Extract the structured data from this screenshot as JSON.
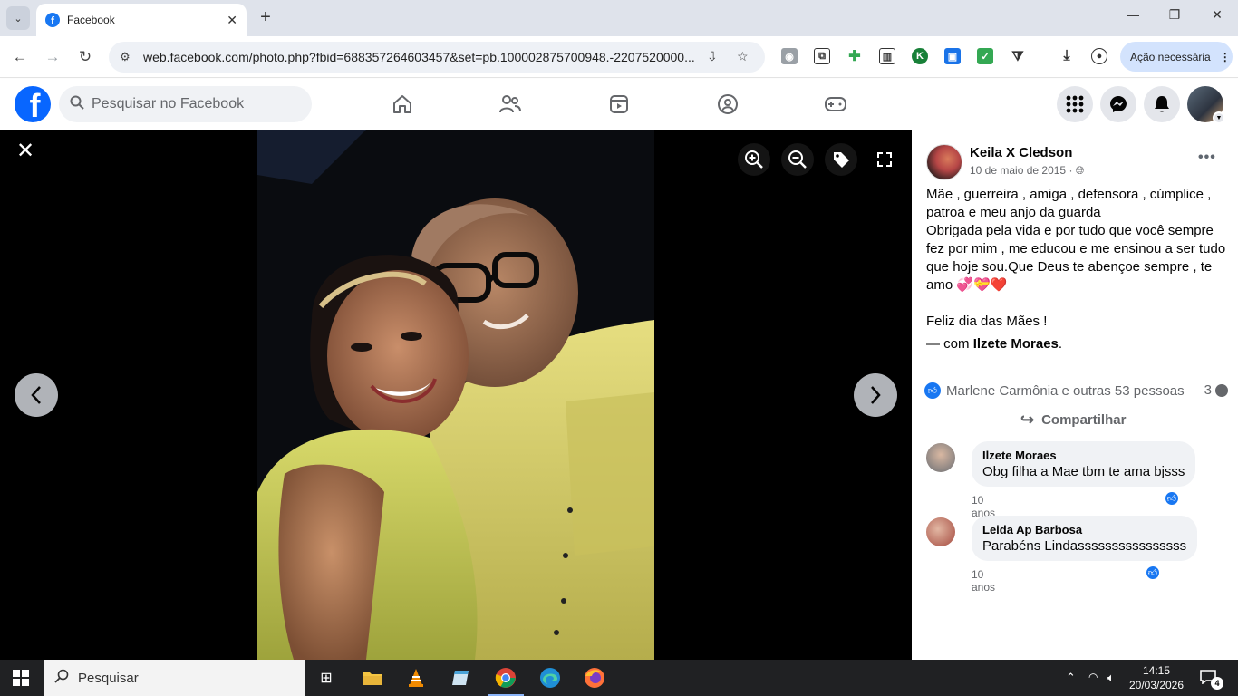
{
  "browser": {
    "tab_title": "Facebook",
    "url": "web.facebook.com/photo.php?fbid=688357264603457&set=pb.100002875700948.-2207520000...",
    "action_button": "Ação necessária"
  },
  "facebook": {
    "search_placeholder": "Pesquisar no Facebook",
    "brand_color": "#0866ff",
    "nav_icons": [
      "home-icon",
      "friends-icon",
      "video-icon",
      "groups-icon",
      "gaming-icon"
    ]
  },
  "post": {
    "author": "Keila X Cledson",
    "date": "10 de maio de 2015",
    "date_separator": "·",
    "text_line1": "Mãe , guerreira , amiga , defensora , cúmplice , patroa e meu anjo da guarda",
    "text_line2": "Obrigada pela vida e por tudo que você sempre fez por mim , me educou e me ensinou a ser tudo que hoje sou.Que Deus te abençoe sempre , te amo",
    "emojis": "💞💝❤️",
    "text_line3": "Feliz dia das Mães !",
    "with_prefix": "— com",
    "with_name": "Ilzete Moraes",
    "with_suffix": ".",
    "reactions_text": "Marlene Carmônia e outras 53 pessoas",
    "comment_count": "3",
    "share_label": "Compartilhar"
  },
  "comments": [
    {
      "name": "Ilzete Moraes",
      "text": "Obg filha a Mae tbm te ama bjsss",
      "time": "10 anos"
    },
    {
      "name": "Leida Ap Barbosa",
      "text": "Parabéns Lindassssssssssssssss",
      "time": "10 anos"
    }
  ],
  "taskbar": {
    "search_placeholder": "Pesquisar",
    "time": "14:15",
    "date": "20/03/2026",
    "notifications": "4"
  }
}
